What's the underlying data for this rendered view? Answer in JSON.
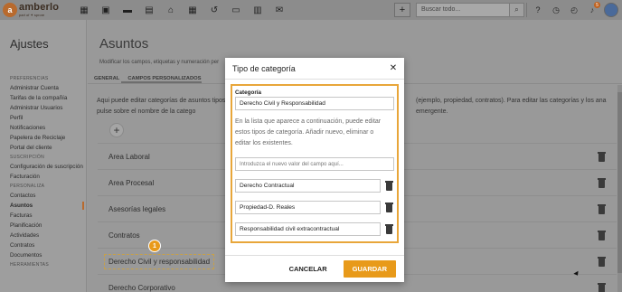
{
  "topbar": {
    "logo_mark": "a",
    "logo_name": "amberlo",
    "logo_sub": "part of ✦ sprore",
    "plus_symbol": "+",
    "search_placeholder": "Buscar todo...",
    "notification_count": "5",
    "icons": [
      "grid-icon",
      "contacts-icon",
      "briefcase-icon",
      "document-icon",
      "court-icon",
      "calendar-icon",
      "history-icon",
      "folder-icon",
      "invoice-icon",
      "mail-icon",
      "search-icon",
      "help-icon",
      "timer-icon",
      "clock-icon",
      "bell-icon",
      "avatar"
    ]
  },
  "sidebar": {
    "title": "Ajustes",
    "sections": [
      {
        "heading": "PREFERENCIAS",
        "items": [
          "Administrar Cuenta",
          "Tarifas de la compañía",
          "Administrar Usuarios",
          "Perfil",
          "Notificaciones",
          "Papelera de Reciclaje",
          "Portal del cliente"
        ]
      },
      {
        "heading": "SUSCRIPCIÓN",
        "items": [
          "Configuración de suscripción",
          "Facturación"
        ]
      },
      {
        "heading": "PERSONALIZA",
        "items": [
          "Contactos",
          "Asuntos",
          "Facturas",
          "Planificación",
          "Actividades",
          "Contratos",
          "Documentos"
        ]
      },
      {
        "heading": "HERRAMIENTAS",
        "items": []
      }
    ],
    "active_item": "Asuntos"
  },
  "main": {
    "title": "Asuntos",
    "subtitle": "Modificar los campos, etiquetas y numeración per",
    "tabs": [
      "GENERAL",
      "CAMPOS PERSONALIZADOS"
    ],
    "desc_left": "Aqui puede editar categorías de asuntos tipos pulse sobre el nombre de la catego",
    "desc_right": "(ejemplo, propiedad, contratos). Para editar las categorías y los ana emergente.",
    "add_symbol": "+",
    "rows": [
      "Area Laboral",
      "Area Procesal",
      "Asesorías legales",
      "Contratos",
      "Derecho Civil y responsabilidad",
      "Derecho Corporativo"
    ]
  },
  "modal": {
    "title": "Tipo de categoría",
    "close_symbol": "✕",
    "field_label": "Categoría",
    "field_value": "Derecho Civil y Responsabilidad",
    "help": "En la lista que aparece a continuación, puede editar estos tipos de categoría. Añadir nuevo, eliminar o editar los existentes.",
    "new_placeholder": "Introduzca el nuevo valor del campo aquí...",
    "items": [
      "Derecho Contractual",
      "Propiedad-D. Reales",
      "Responsabilidad civil extracontractual"
    ],
    "cancel_label": "CANCELAR",
    "save_label": "GUARDAR"
  },
  "markers": [
    "1",
    "2",
    "3"
  ],
  "colors": {
    "accent": "#e89a1a",
    "brand": "#b86a2e"
  }
}
